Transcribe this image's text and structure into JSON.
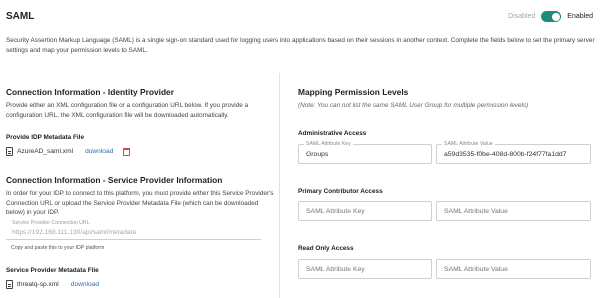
{
  "header": {
    "title": "SAML",
    "toggle_off_label": "Disabled",
    "toggle_on_label": "Enabled",
    "toggle_state": "on",
    "accent_color": "#1e8c7c"
  },
  "description": "Security Assertion Markup Language (SAML) is a single sign-on standard used for logging users into applications based on their sessions in another context. Complete the fields below to set the primary server settings and map your permission levels to SAML.",
  "left": {
    "idp": {
      "heading": "Connection Information - Identity Provider",
      "text": "Provide either an XML configuration file or a configuration URL below. If you provide a configuration URL, the XML configuration file will be downloaded automatically.",
      "metadata_heading": "Provide IDP Metadata File",
      "file_name": "AzureAD_saml.xml",
      "download_label": "download"
    },
    "sp": {
      "heading": "Connection Information - Service Provider Information",
      "text": "In order for your IDP to connect to this platform, you must provide either this Service Provider's Connection URL or upload the Service Provider Metadata File (which can be downloaded below) in your IDP.",
      "url_label": "Service Provider Connection URL",
      "url_value": "https://192.168.111.130/api/saml/metadata",
      "helper": "Copy and paste this to your IDP platform",
      "metadata_heading": "Service Provider Metadata File",
      "file_name": "threatq-sp.xml",
      "download_label": "download"
    }
  },
  "right": {
    "heading": "Mapping Permission Levels",
    "note": "(Note: You can not list the same SAML User Group for multiple permission levels)",
    "admin": {
      "label": "Administrative Access",
      "key_label": "SAML Attribute Key",
      "key_value": "Groups",
      "value_label": "SAML Attribute Value",
      "value_value": "a59d3535-f0be-408d-800b-f24f77fa1dd7"
    },
    "contributor": {
      "label": "Primary Contributor Access",
      "key_placeholder": "SAML Attribute Key",
      "value_placeholder": "SAML Attribute Value"
    },
    "readonly": {
      "label": "Read Only Access",
      "key_placeholder": "SAML Attribute Key",
      "value_placeholder": "SAML Attribute Value"
    }
  }
}
